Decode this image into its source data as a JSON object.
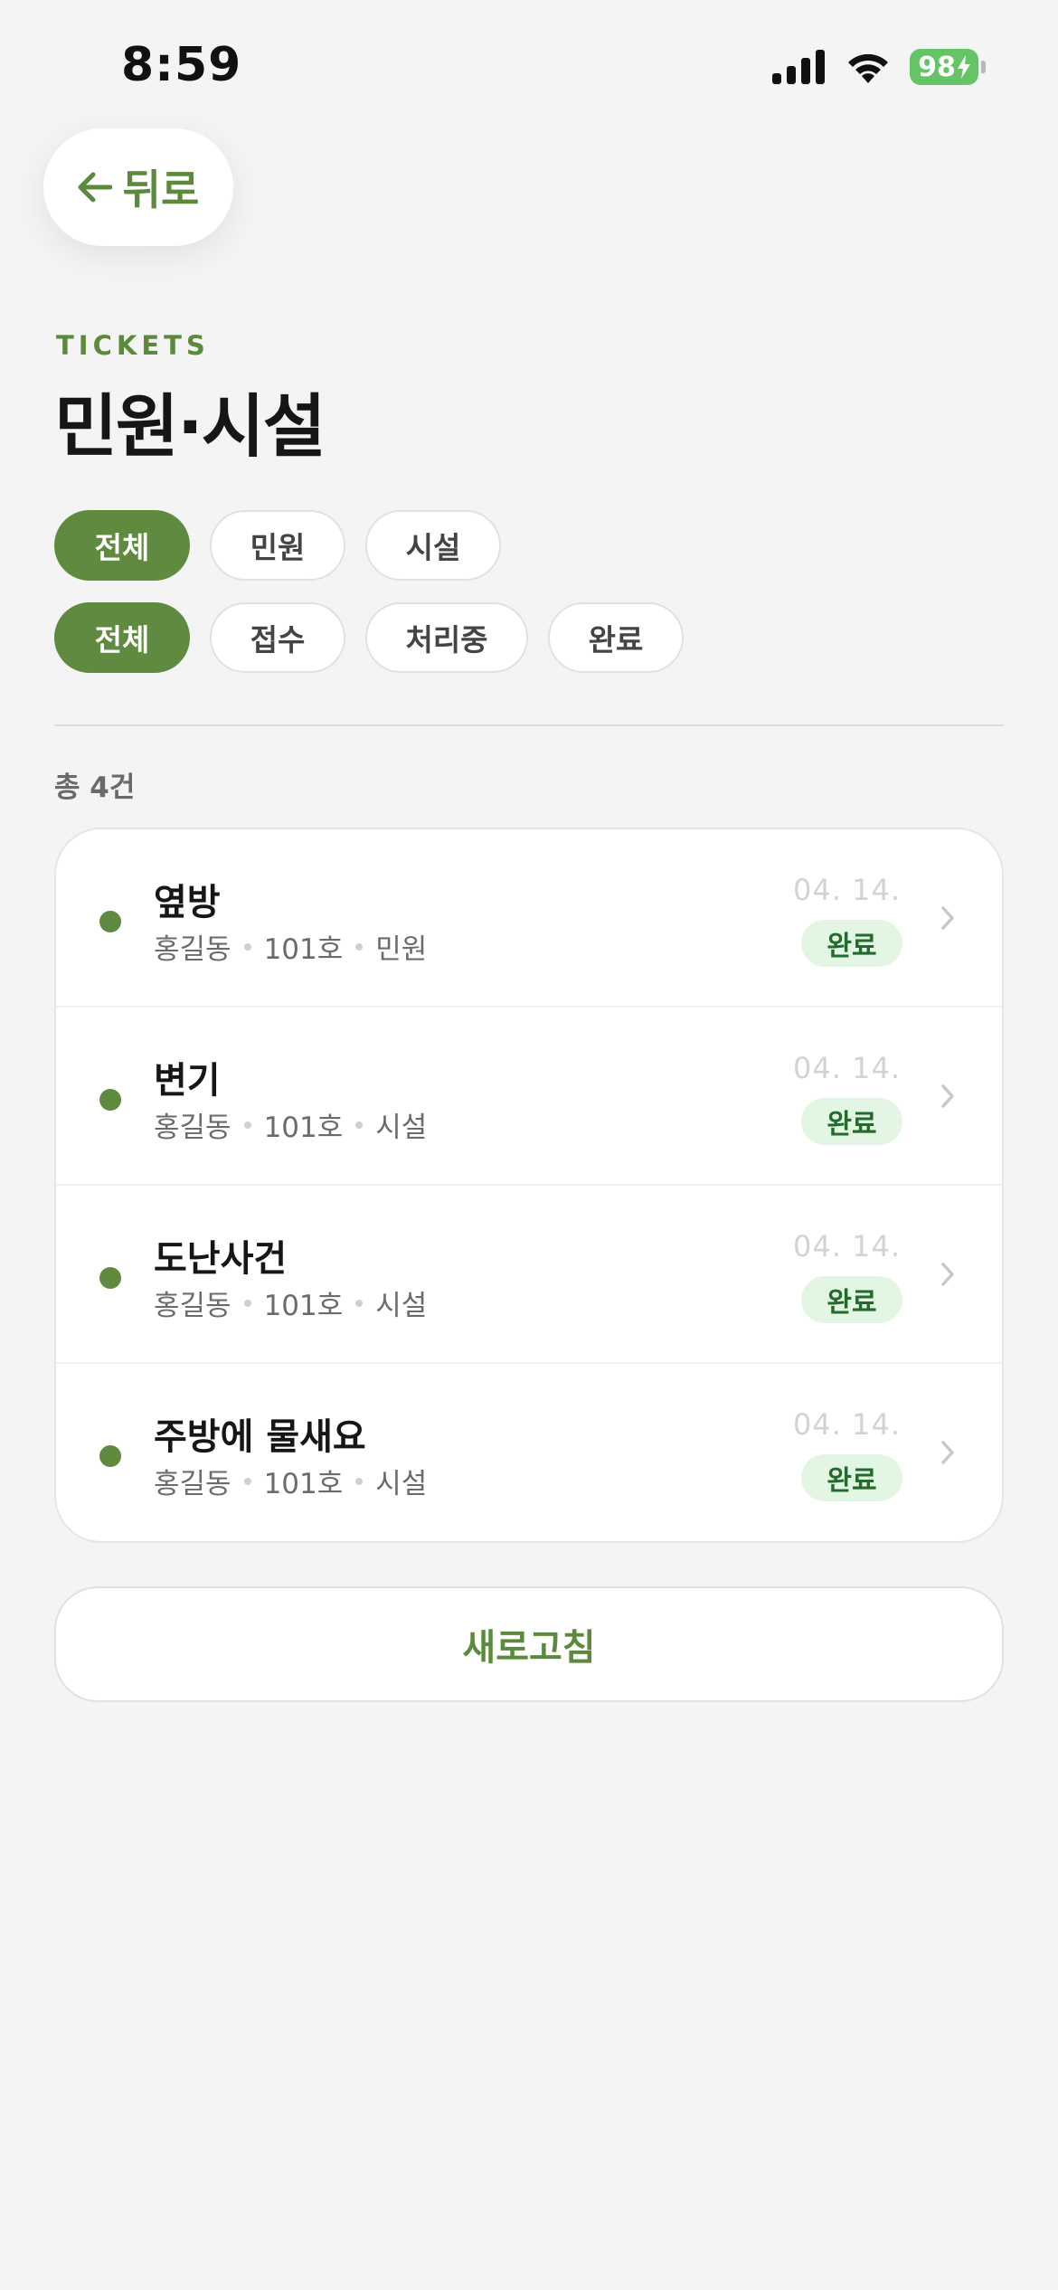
{
  "status_bar": {
    "time": "8:59",
    "battery": "98",
    "battery_color": "#65c466"
  },
  "header": {
    "back_label": "뒤로",
    "eyebrow": "TICKETS",
    "title": "민원·시설"
  },
  "filters": {
    "type": [
      "전체",
      "민원",
      "시설"
    ],
    "type_selected": "전체",
    "status": [
      "전체",
      "접수",
      "처리중",
      "완료"
    ],
    "status_selected": "전체"
  },
  "list": {
    "total_label": "총 4건",
    "items": [
      {
        "title": "옆방",
        "name": "홍길동",
        "room": "101호",
        "category": "민원",
        "date": "04. 14.",
        "status": "완료"
      },
      {
        "title": "변기",
        "name": "홍길동",
        "room": "101호",
        "category": "시설",
        "date": "04. 14.",
        "status": "완료"
      },
      {
        "title": "도난사건",
        "name": "홍길동",
        "room": "101호",
        "category": "시설",
        "date": "04. 14.",
        "status": "완료"
      },
      {
        "title": "주방에 물새요",
        "name": "홍길동",
        "room": "101호",
        "category": "시설",
        "date": "04. 14.",
        "status": "완료"
      }
    ]
  },
  "refresh_label": "새로고침",
  "colors": {
    "accent": "#5f8a3f",
    "badge_bg": "#e3f6e3",
    "badge_text": "#236b2c",
    "background": "#f4f4f4"
  }
}
